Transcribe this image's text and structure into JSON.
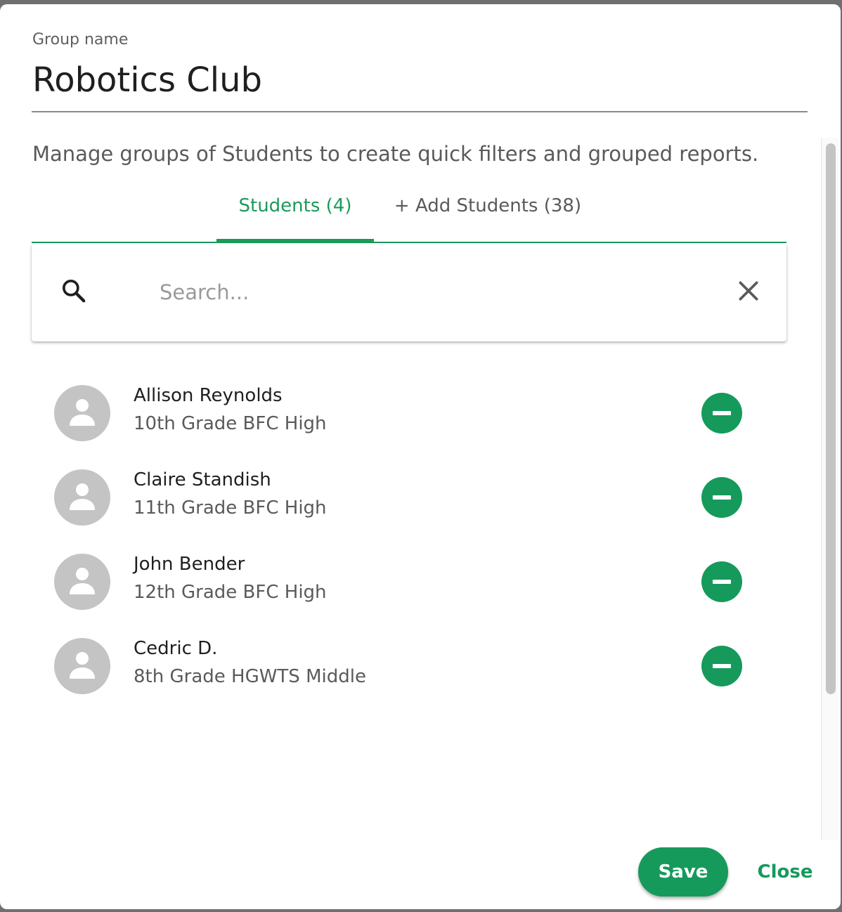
{
  "dialog": {
    "group_label": "Group name",
    "group_name": "Robotics Club",
    "description": "Manage groups of Students to create quick filters and grouped reports."
  },
  "tabs": [
    {
      "label": "Students (4)",
      "active": true
    },
    {
      "label": "+ Add Students (38)",
      "active": false
    }
  ],
  "search": {
    "placeholder": "Search...",
    "value": ""
  },
  "students": [
    {
      "name": "Allison Reynolds",
      "detail": "10th Grade BFC High"
    },
    {
      "name": "Claire Standish",
      "detail": "11th Grade BFC High"
    },
    {
      "name": "John Bender",
      "detail": "12th Grade BFC High"
    },
    {
      "name": "Cedric D.",
      "detail": "8th Grade HGWTS Middle"
    }
  ],
  "footer": {
    "save_label": "Save",
    "close_label": "Close"
  },
  "colors": {
    "accent": "#159a5b",
    "avatar_bg": "#c4c4c4"
  },
  "icons": {
    "search": "search-icon",
    "clear": "close-icon",
    "avatar": "person-icon",
    "remove": "minus-circle-icon"
  }
}
